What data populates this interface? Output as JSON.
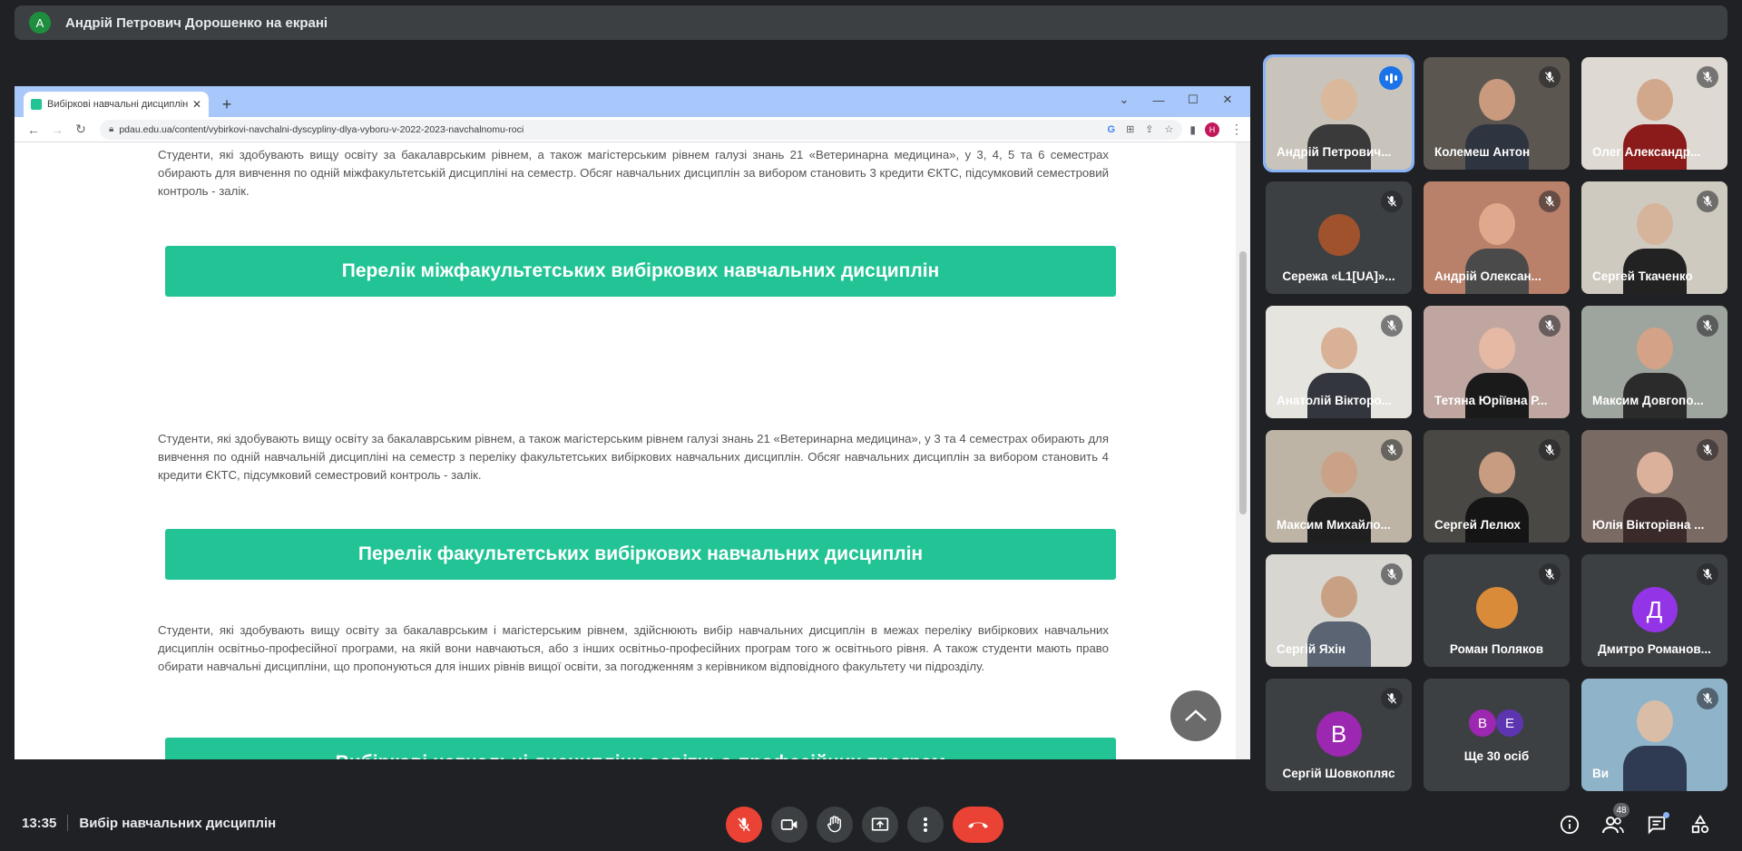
{
  "presenter": {
    "initial": "А",
    "text": "Андрій Петрович Дорошенко на екрані"
  },
  "browser": {
    "tab_title": "Вибіркові навчальні дисциплін",
    "url": "pdau.edu.ua/content/vybirkovi-navchalni-dyscypliny-dlya-vyboru-v-2022-2023-navchalnomu-roci",
    "profile_initial": "Н"
  },
  "page": {
    "para1": "Студенти, які здобувають вищу освіту за бакалаврським рівнем, а також магістерським рівнем галузі знань 21 «Ветеринарна медицина», у 3, 4, 5 та 6 семестрах обирають для вивчення по одній міжфакультетській дисципліні на семестр. Обсяг навчальних дисциплін за вибором становить 3 кредити ЄКТС, підсумковий семестровий контроль - залік.",
    "button1": "Перелік міжфакультетських вибіркових навчальних дисциплін",
    "para2": "Студенти, які здобувають вищу освіту за бакалаврським рівнем, а також магістерським рівнем галузі знань 21 «Ветеринарна медицина», у 3 та 4 семестрах обирають для вивчення по одній навчальній дисципліні на семестр з переліку факультетських вибіркових навчальних дисциплін. Обсяг навчальних дисциплін за вибором становить 4 кредити ЄКТС, підсумковий семестровий контроль - залік.",
    "button2": "Перелік факультетських вибіркових навчальних дисциплін",
    "para3": "Студенти, які здобувають вищу освіту за бакалаврським і магістерським  рівнем, здійснюють вибір навчальних дисциплін в межах переліку вибіркових навчальних дисциплін освітньо-професійної програми, на якій вони навчаються, або з інших освітньо-професійних програм того ж освітнього рівня. А також студенти мають право обирати навчальні дисципліни, що пропонуються для інших рівнів вищої освіти, за погодженням з керівником відповідного факультету чи підрозділу.",
    "button3": "Вибіркові навчальні дисципліни освітньо-професійних програм"
  },
  "participants": [
    {
      "name": "Андрій Петрович...",
      "type": "video",
      "speaking": true,
      "skin": "#d9b89c",
      "shirt": "#3a3a3a",
      "bg": "#c9c4bb"
    },
    {
      "name": "Колемеш Антон",
      "type": "video",
      "skin": "#c99a7e",
      "shirt": "#2e3440",
      "bg": "#5b5650"
    },
    {
      "name": "Олег Александр...",
      "type": "video",
      "skin": "#d2a88c",
      "shirt": "#8b1a1a",
      "bg": "#dedad3"
    },
    {
      "name": "Сережа «L1[UA]»...",
      "type": "avatar-img",
      "color": "#a0522d"
    },
    {
      "name": "Андрій Олексан...",
      "type": "video",
      "skin": "#e0a98e",
      "shirt": "#4a4a4a",
      "bg": "#b9806a"
    },
    {
      "name": "Сергей Ткаченко",
      "type": "video",
      "skin": "#d6b49c",
      "shirt": "#222222",
      "bg": "#cfcac0"
    },
    {
      "name": "Анатолій Вікторо...",
      "type": "video",
      "skin": "#d8b196",
      "shirt": "#33363d",
      "bg": "#e6e4df"
    },
    {
      "name": "Тетяна Юріївна Р...",
      "type": "video",
      "skin": "#e5b9a3",
      "shirt": "#1a1a1a",
      "bg": "#bfa6a0"
    },
    {
      "name": "Максим Довгопо...",
      "type": "video",
      "skin": "#d4a387",
      "shirt": "#2b2b2b",
      "bg": "#9ea49e"
    },
    {
      "name": "Максим Михайло...",
      "type": "video",
      "skin": "#caa287",
      "shirt": "#1f1f1f",
      "bg": "#bdb4a5"
    },
    {
      "name": "Сергей Лелюх",
      "type": "video",
      "skin": "#c79c80",
      "shirt": "#151515",
      "bg": "#4a4844"
    },
    {
      "name": "Юлія Вікторівна ...",
      "type": "video",
      "skin": "#dcb19b",
      "shirt": "#3a2a2a",
      "bg": "#7a6a64"
    },
    {
      "name": "Сергій Яхін",
      "type": "video",
      "skin": "#c8a184",
      "shirt": "#5a6472",
      "bg": "#d8d6d1"
    },
    {
      "name": "Роман Поляков",
      "type": "avatar-img",
      "color": "#d98b3a"
    },
    {
      "name": "Дмитро Романов...",
      "type": "letter",
      "letter": "Д",
      "color": "#9334e6"
    },
    {
      "name": "Сергій Шовкопляс",
      "type": "letter",
      "letter": "В",
      "color": "#9c27b0"
    },
    {
      "name": "Ще 30 осіб",
      "type": "more",
      "letters": [
        "В",
        "Е"
      ],
      "colors": [
        "#9c27b0",
        "#5e35b1"
      ]
    },
    {
      "name": "Ви",
      "type": "video",
      "skin": "#d9bda6",
      "shirt": "#2f3b52",
      "bg": "#8fb3c9"
    }
  ],
  "bottom": {
    "time": "13:35",
    "meeting_title": "Вибір навчальних дисциплін",
    "people_count": "48"
  }
}
